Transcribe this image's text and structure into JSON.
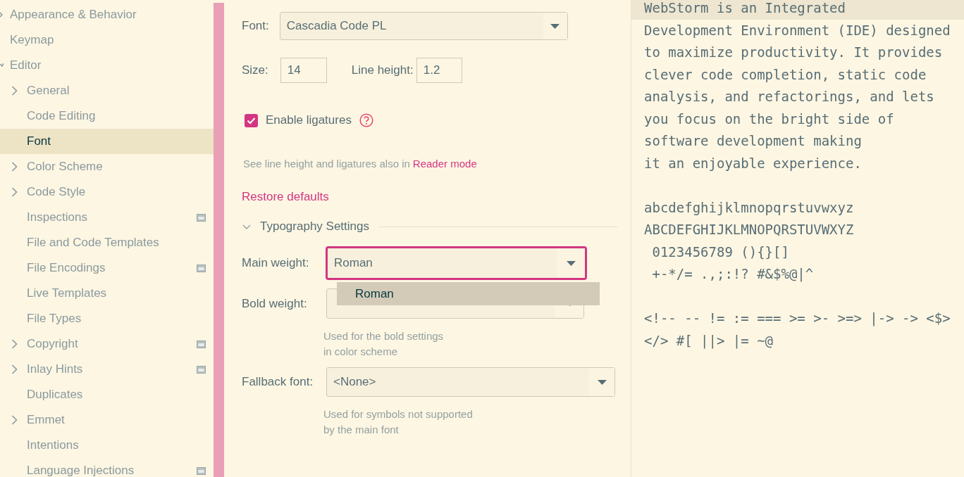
{
  "sidebar": {
    "items": [
      {
        "label": "Appearance & Behavior",
        "expanded": false
      },
      {
        "label": "Keymap"
      },
      {
        "label": "Editor",
        "expanded": true,
        "children": [
          {
            "label": "General",
            "kind": "group",
            "selected": false,
            "project_icon": false
          },
          {
            "label": "Code Editing",
            "kind": "leaf",
            "selected": false,
            "project_icon": false
          },
          {
            "label": "Font",
            "kind": "leaf",
            "selected": true,
            "project_icon": false
          },
          {
            "label": "Color Scheme",
            "kind": "group",
            "selected": false,
            "project_icon": false
          },
          {
            "label": "Code Style",
            "kind": "group",
            "selected": false,
            "project_icon": false
          },
          {
            "label": "Inspections",
            "kind": "leaf",
            "selected": false,
            "project_icon": true
          },
          {
            "label": "File and Code Templates",
            "kind": "leaf",
            "selected": false,
            "project_icon": false
          },
          {
            "label": "File Encodings",
            "kind": "leaf",
            "selected": false,
            "project_icon": true
          },
          {
            "label": "Live Templates",
            "kind": "leaf",
            "selected": false,
            "project_icon": false
          },
          {
            "label": "File Types",
            "kind": "leaf",
            "selected": false,
            "project_icon": false
          },
          {
            "label": "Copyright",
            "kind": "group",
            "selected": false,
            "project_icon": true
          },
          {
            "label": "Inlay Hints",
            "kind": "group",
            "selected": false,
            "project_icon": true
          },
          {
            "label": "Duplicates",
            "kind": "leaf",
            "selected": false,
            "project_icon": false
          },
          {
            "label": "Emmet",
            "kind": "group",
            "selected": false,
            "project_icon": false
          },
          {
            "label": "Intentions",
            "kind": "leaf",
            "selected": false,
            "project_icon": false
          },
          {
            "label": "Language Injections",
            "kind": "leaf",
            "selected": false,
            "project_icon": true
          }
        ]
      }
    ]
  },
  "settings": {
    "font": {
      "label": "Font:",
      "value": "Cascadia Code PL"
    },
    "size": {
      "label": "Size:",
      "value": "14"
    },
    "line_height": {
      "label": "Line height:",
      "value": "1.2"
    },
    "ligatures": {
      "label": "Enable ligatures",
      "checked": true
    },
    "note": {
      "text": "See line height and ligatures also in",
      "link": "Reader mode"
    },
    "restore": "Restore defaults",
    "typography": {
      "title": "Typography Settings",
      "expanded": true,
      "main_weight": {
        "label": "Main weight:",
        "value": "Roman",
        "focused": true
      },
      "popup": [
        {
          "label": "Roman",
          "selected": true
        }
      ],
      "bold_weight": {
        "label": "Bold weight:"
      },
      "bold_hint": [
        "Used for the bold settings",
        "in color scheme"
      ],
      "fallback": {
        "label": "Fallback font:",
        "value": "<None>"
      },
      "fallback_hint": [
        "Used for symbols not supported",
        "by the main font"
      ]
    }
  },
  "preview": {
    "blocks": [
      {
        "lines": [
          {
            "text": "WebStorm is an Integrated ",
            "current": true
          },
          {
            "text": "Development Environment (IDE) designed",
            "current": false
          },
          {
            "text": "to maximize productivity. It provides",
            "current": false
          },
          {
            "text": "clever code completion, static code",
            "current": false
          },
          {
            "text": "analysis, and refactorings, and lets",
            "current": false
          },
          {
            "text": "you focus on the bright side of",
            "current": false
          },
          {
            "text": "software development making",
            "current": false
          },
          {
            "text": "it an enjoyable experience.",
            "current": false
          }
        ]
      },
      {
        "lines": [
          {
            "text": "abcdefghijklmnopqrstuvwxyz",
            "current": false
          },
          {
            "text": "ABCDEFGHIJKLMNOPQRSTUVWXYZ",
            "current": false
          },
          {
            "text": " 0123456789 (){}[]",
            "current": false
          },
          {
            "text": " +-*/= .,;:!? #&$%@|^",
            "current": false
          }
        ]
      },
      {
        "lines": [
          {
            "text": "<!-- -- != := === >= >- >=> |-> -> <$>",
            "current": false
          },
          {
            "text": "</> #[ ||> |= ~@",
            "current": false
          }
        ]
      }
    ]
  }
}
